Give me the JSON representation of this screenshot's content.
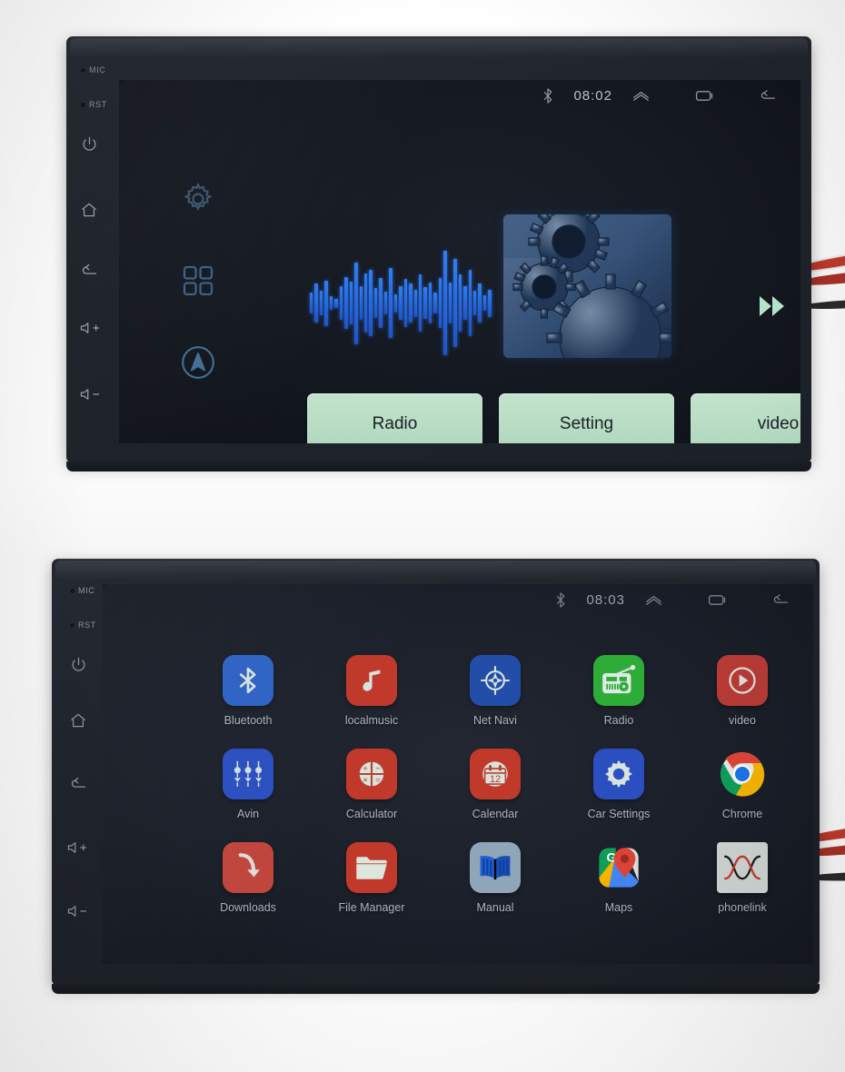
{
  "scene": {
    "description": "Two photographs of an Android car head unit (2-DIN stereo) on a white surface",
    "background_color": "#ffffff",
    "unit_color": "#23282f"
  },
  "bezel": {
    "labels": [
      {
        "name": "mic",
        "text": "MIC"
      },
      {
        "name": "rst",
        "text": "RST"
      }
    ],
    "keys": [
      {
        "name": "power",
        "icon": "power-icon"
      },
      {
        "name": "home",
        "icon": "home-icon"
      },
      {
        "name": "back",
        "icon": "back-icon"
      },
      {
        "name": "volume-up",
        "icon": "volume-up-icon",
        "text": "+"
      },
      {
        "name": "volume-down",
        "icon": "volume-down-icon",
        "text": "-"
      }
    ]
  },
  "top_unit": {
    "statusbar": {
      "bluetooth_icon": "bluetooth-icon",
      "time": "08:02",
      "collapse_icon": "chevron-up-icon",
      "recents_icon": "recents-icon",
      "back_icon": "back-icon"
    },
    "dock": [
      {
        "name": "settings",
        "icon": "gear-icon"
      },
      {
        "name": "apps",
        "icon": "apps-grid-icon"
      },
      {
        "name": "navigation",
        "icon": "navigation-arrow-icon"
      }
    ],
    "widgets": {
      "waveform": {
        "name": "audio-waveform",
        "color": "#2f7ff0",
        "bars": [
          18,
          34,
          22,
          40,
          12,
          8,
          30,
          46,
          38,
          72,
          30,
          52,
          58,
          26,
          44,
          20,
          62,
          16,
          30,
          42,
          34,
          24,
          50,
          28,
          36,
          18,
          44,
          92,
          36,
          78,
          50,
          30,
          58,
          22,
          34,
          14,
          24
        ]
      },
      "thumbnail": {
        "name": "gears-thumbnail",
        "subject": "mechanical gears"
      },
      "next_icon": "fast-forward-icon",
      "next_color": "#b8e6cd"
    },
    "buttons": [
      {
        "label": "Radio"
      },
      {
        "label": "Setting"
      },
      {
        "label": "video"
      }
    ],
    "button_color": "#b7dcc4",
    "page_indicator": {
      "name": "page-dot",
      "pages": 1,
      "current": 1
    }
  },
  "bottom_unit": {
    "statusbar": {
      "bluetooth_icon": "bluetooth-icon",
      "time": "08:03",
      "collapse_icon": "chevron-up-icon",
      "recents_icon": "recents-icon",
      "back_icon": "back-icon"
    },
    "apps": [
      {
        "label": "Bluetooth",
        "icon": "bluetooth-icon",
        "tile_color": "#2d62c4"
      },
      {
        "label": "localmusic",
        "icon": "music-note-icon",
        "tile_color": "#c0392b"
      },
      {
        "label": "Net Navi",
        "icon": "compass-icon",
        "tile_color": "#234ea8"
      },
      {
        "label": "Radio",
        "icon": "radio-icon",
        "tile_color": "#2eac38"
      },
      {
        "label": "video",
        "icon": "play-circle-icon",
        "tile_color": "#b63a36"
      },
      {
        "label": "Avin",
        "icon": "av-input-icon",
        "tile_color": "#2b4ec0"
      },
      {
        "label": "Calculator",
        "icon": "calculator-icon",
        "tile_color": "#c0392b"
      },
      {
        "label": "Calendar",
        "icon": "calendar-icon",
        "tile_color": "#c0392b"
      },
      {
        "label": "Car Settings",
        "icon": "gear-icon",
        "tile_color": "#2b4ec0"
      },
      {
        "label": "Chrome",
        "icon": "chrome-icon",
        "tile_color": "none"
      },
      {
        "label": "Downloads",
        "icon": "download-arrow-icon",
        "tile_color": "#c0453c"
      },
      {
        "label": "File Manager",
        "icon": "folder-icon",
        "tile_color": "#c0392b"
      },
      {
        "label": "Manual",
        "icon": "book-icon",
        "tile_color": "#8fa6b8"
      },
      {
        "label": "Maps",
        "icon": "maps-pin-icon",
        "tile_color": "none"
      },
      {
        "label": "phonelink",
        "icon": "phonelink-icon",
        "tile_color": "#ced4d2"
      }
    ]
  }
}
